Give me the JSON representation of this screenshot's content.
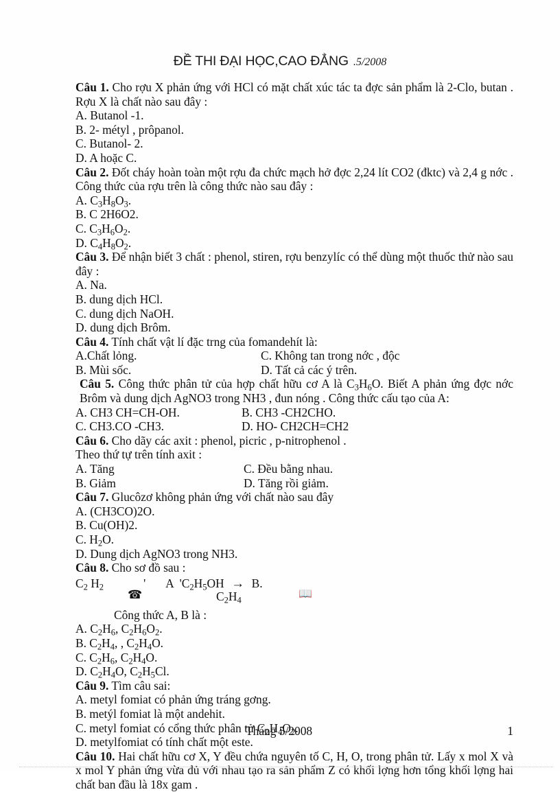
{
  "header": {
    "title": "ĐỀ THI ĐẠI HỌC,CAO ĐẲNG",
    "date": ".5/2008"
  },
  "questions": [
    {
      "label": "Câu 1.",
      "prompt": " Cho rợu   X phản ứng với HCl có mặt chất xúc tác ta đợc   sản phẩm là 2-Clo, butan . Rợu   X là chất nào sau đây :",
      "options": [
        "A. Butanol -1.",
        "B. 2- métyl , prôpanol.",
        "C. Butanol- 2.",
        "D.  A hoặc C."
      ]
    },
    {
      "label": "Câu 2.",
      "prompt": " Đốt cháy hoàn toàn một rợu   đa chức mạch hở đợc   2,24 lít CO2 (đktc) và 2,4 g nớc   . Công thức của rợu   trên là công thức nào sau đây :",
      "options": [
        "A. C3H8O3.",
        "B. C  2H6O2.",
        "C. C3H6O2.",
        "D. C4H8O2."
      ]
    },
    {
      "label": "Câu 3.",
      "prompt": " Để nhận biết 3 chất : phenol, stiren, rợu   benzylíc có thể dùng một thuốc thử nào sau đây :",
      "options": [
        "A. Na.",
        "B. dung dịch HCl.",
        "C. dung dịch NaOH.",
        "D. dung dịch Brôm."
      ]
    },
    {
      "label": "Câu 4.",
      "prompt": " Tính chất vật lí đặc trng   của fomandehít là:",
      "option_rows": [
        {
          "left": "A.Chất lỏng.",
          "right": "C. Không tan trong nớc   , độc"
        },
        {
          "left": "B. Mùi sốc.",
          "right": "D. Tất cả các ý trên."
        }
      ]
    },
    {
      "label": "Câu 5.",
      "prompt": " Công thức phân tử của hợp chất hữu cơ A là C3H6O. Biết A phản ứng đợc nớc   Brôm  và dung dịch AgNO3 trong NH3 , đun nóng . Công thức cấu tạo của A:",
      "option_rows": [
        {
          "left": "A. CH3 CH=CH-OH.",
          "right": "B. CH3 -CH2CHO."
        },
        {
          "left": "C. CH3.CO -CH3.",
          "right": "D. HO- CH2CH=CH2"
        }
      ]
    },
    {
      "label": "Câu 6.",
      "prompt": " Cho dãy các axit : phenol, picric , p-nitrophenol .",
      "prompt2": "Theo thứ tự trên tính axit :",
      "option_rows": [
        {
          "left": "A. Tăng",
          "right": "C. Đều bằng nhau."
        },
        {
          "left": "B. Giảm",
          "right": "D. Tăng rồi giảm."
        }
      ]
    },
    {
      "label": "Câu 7.",
      "prompt": " Glucôzơ không phản ứng với chất nào  sau đây",
      "options": [
        "A.  (CH3CO)2O.",
        "B. Cu(OH)2.",
        "C. H2O.",
        "D. Dung dịch AgNO3 trong NH3."
      ]
    },
    {
      "label": "Câu 8.",
      "prompt": " Cho sơ đồ sau :",
      "scheme": {
        "start": "C2 H2",
        "tick1": "'",
        "mid_a": "A",
        "tick2": "'",
        "mid_b": "C2H5OH",
        "arrow": "→",
        "end": "B.",
        "phone_icon": "☎",
        "book_icon": "📖",
        "below_mid": "C2H4",
        "caption": "Công thức A, B là :"
      },
      "options": [
        "A. C2H6, C2H6O2.",
        "B. C2H4, , C2H4O.",
        "C. C2H6, C2H4O.",
        "D. C2H4O, C2H5Cl."
      ]
    },
    {
      "label": "Câu 9.",
      "prompt": " Tìm câu sai:",
      "options": [
        "A. metyl fomiat  có phản ứng tráng gơng.",
        "B. metýl fomiat là một andehit.",
        "C. metyl fomiat có cổng thức phân tử C2H4O2.",
        "D. metylfomiat  có tính chất một este."
      ]
    },
    {
      "label": "Câu 10.",
      "prompt": " Hai chất hữu cơ X, Y đều chứa nguyên tố C, H, O, trong phân tử. Lấy x mol X và x mol Y phản    ứng vừa đủ với nhau tạo ra sản phẩm  Z có khối lợng hơn tổng khối lợng   hai chất ban đầu là 18x gam .",
      "options": []
    }
  ],
  "footer": {
    "month": "Tháng 5/2008",
    "page_number": "1"
  }
}
